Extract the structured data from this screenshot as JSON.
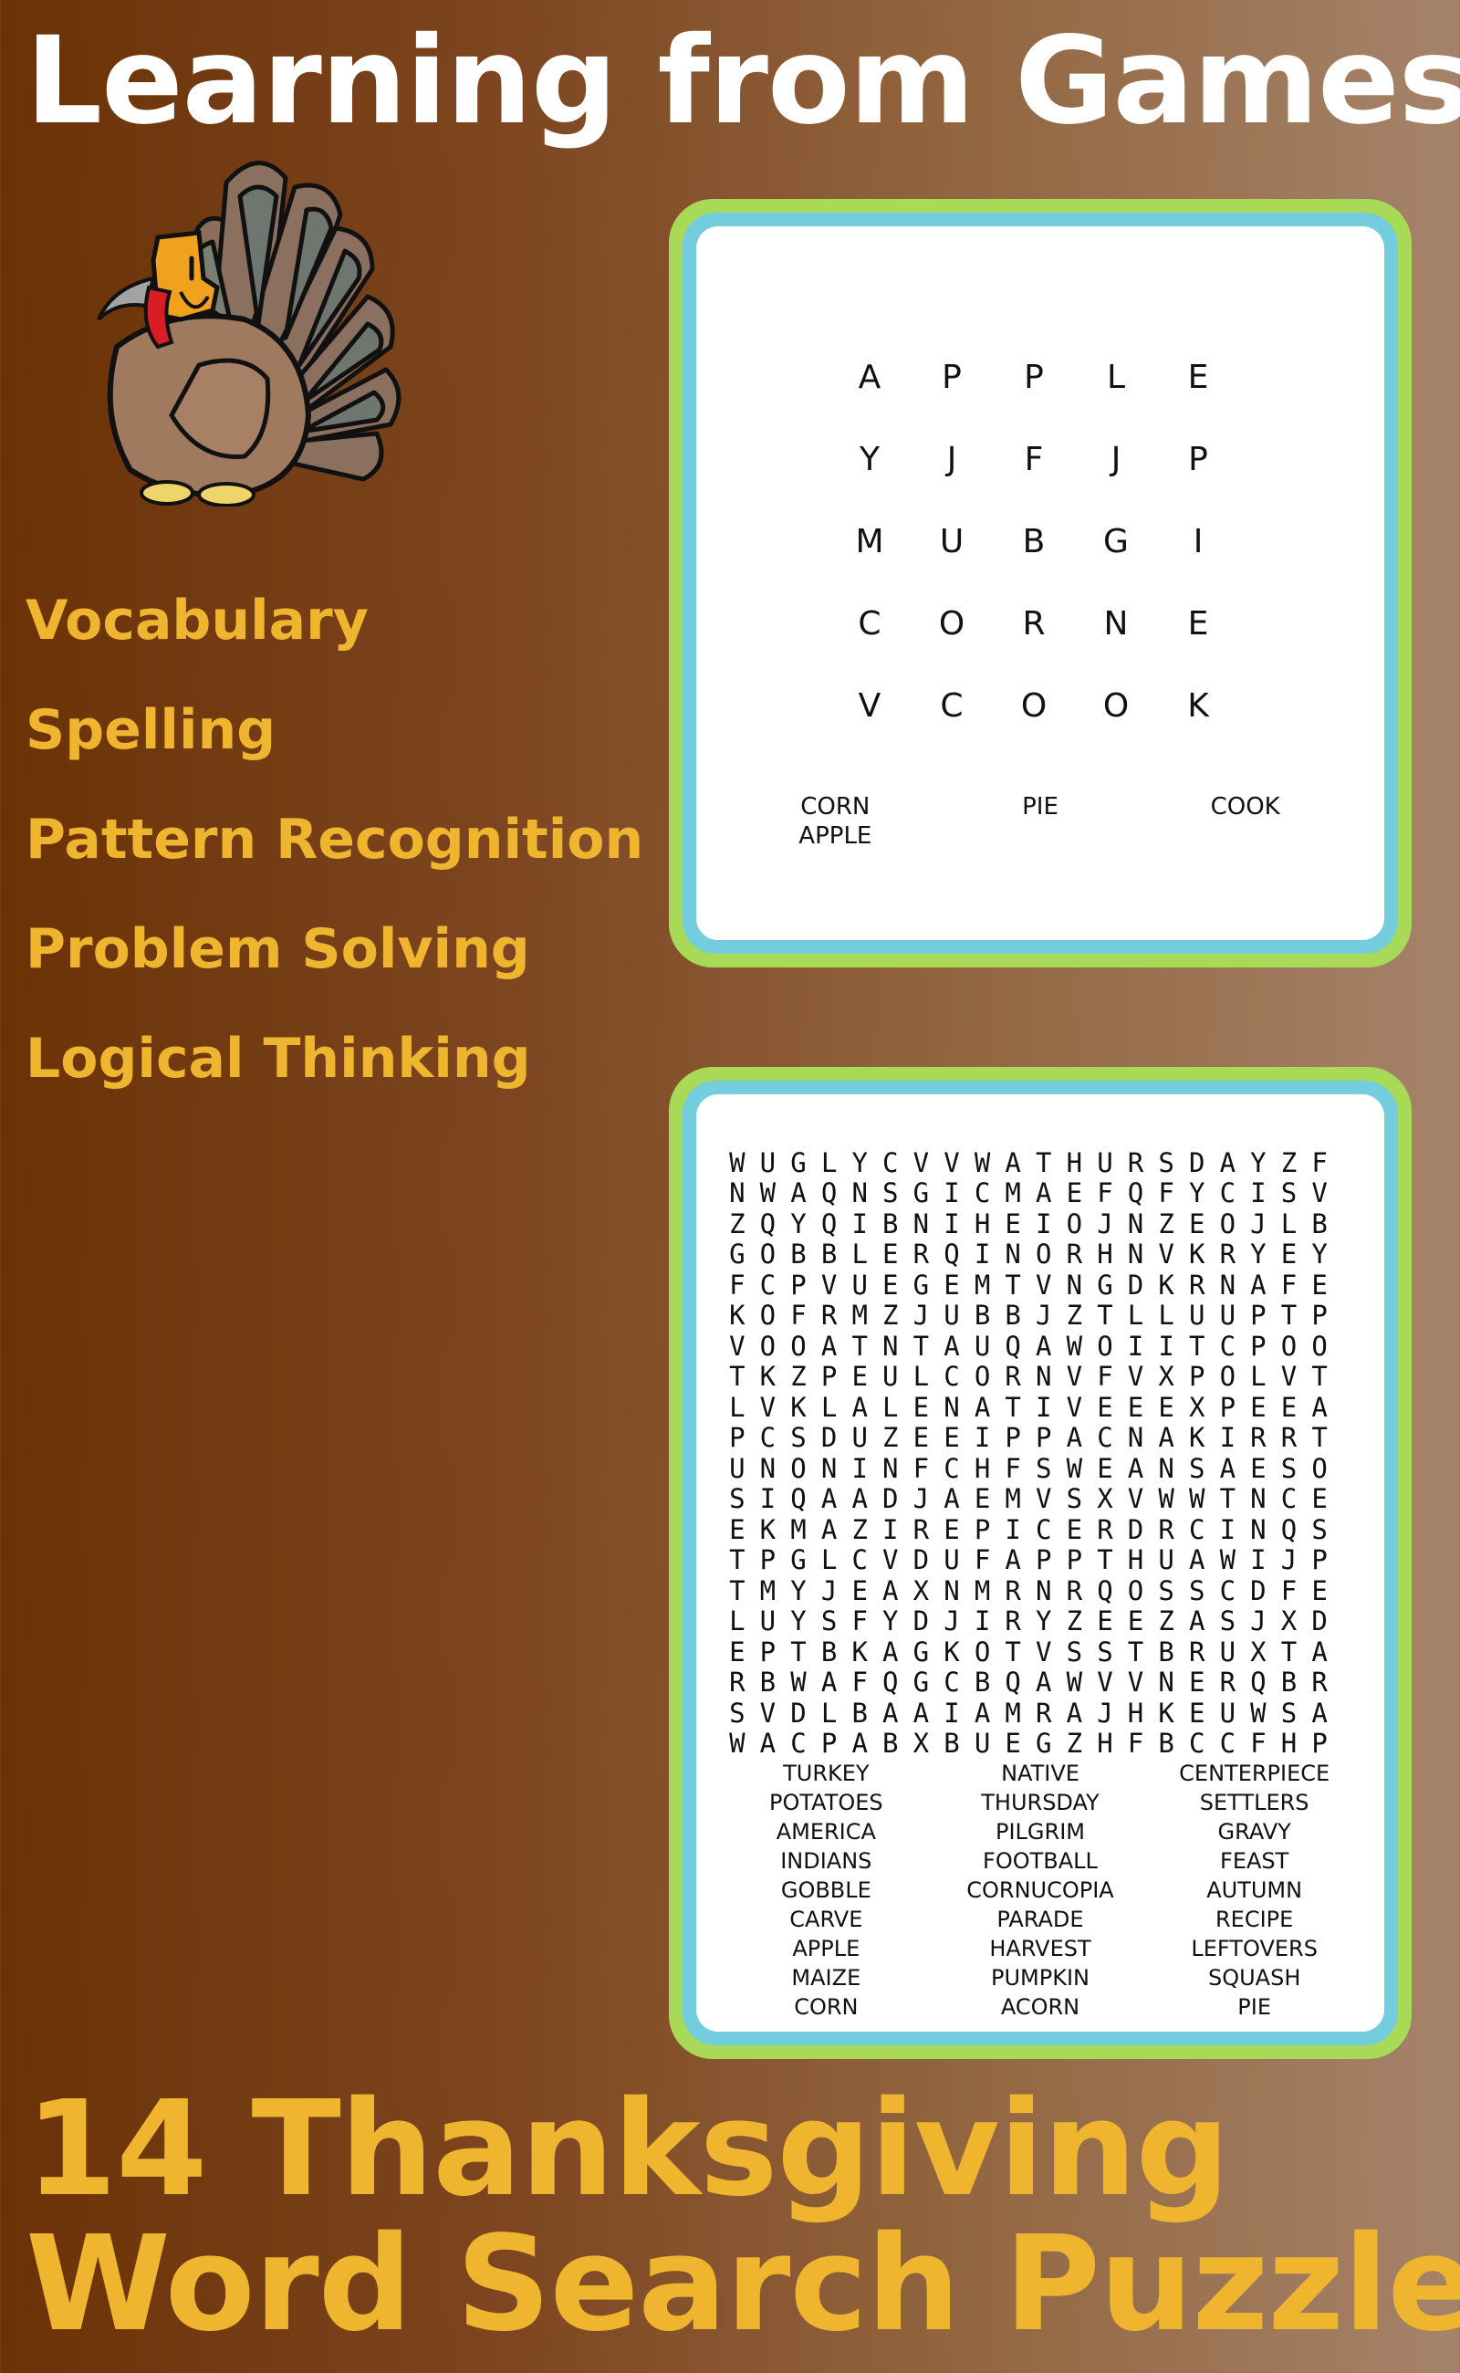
{
  "header": {
    "title": "Learning from Games"
  },
  "colors": {
    "title_text": "#ffffff",
    "accent_text": "#efb52f",
    "frame_outer": "#a8d957",
    "frame_inner": "#74cddc",
    "background_left": "#6b3206",
    "background_right": "#a5836a"
  },
  "illustration": {
    "icon": "turkey-icon"
  },
  "skills": [
    "Vocabulary",
    "Spelling",
    "Pattern Recognition",
    "Problem Solving",
    "Logical Thinking"
  ],
  "small_puzzle": {
    "grid": [
      [
        "A",
        "P",
        "P",
        "L",
        "E"
      ],
      [
        "Y",
        "J",
        "F",
        "J",
        "P"
      ],
      [
        "M",
        "U",
        "B",
        "G",
        "I"
      ],
      [
        "C",
        "O",
        "R",
        "N",
        "E"
      ],
      [
        "V",
        "C",
        "O",
        "O",
        "K"
      ]
    ],
    "words": [
      [
        "CORN",
        "APPLE"
      ],
      [
        "PIE"
      ],
      [
        "COOK"
      ]
    ]
  },
  "large_puzzle": {
    "grid": [
      "WUGLYCVVWATHURSDAYZF",
      "NWAQNSGICMAEFQFYCISV",
      "ZQYQIBNIHEIOJNZEOJLB",
      "GOBBLERQINORHNVKRYEY",
      "FCPVUEGEMTVNGDKRNAFE",
      "KOFRMZJUBBJZTLLUUPTP",
      "VOOATNTAUQAWOIITCPOO",
      "TKZPEULCORNVFVXPOLVT",
      "LVKLALENATIVEEEXPEEA",
      "PCSDUZEEIPPACNAKIRRT",
      "UNONINFCHFSWEANSAESO",
      "SIQAADJAEMVSXVWWTNCE",
      "EKMAZIREPICERDRCINQS",
      "TPGLCVDUFAPPTHUAWIJP",
      "TMYJEAXNMRNRQOSSCDFE",
      "LUYSFYDJIRYZEEZASJXD",
      "EPTBKAGKOTVSSTBRUXTA",
      "RBWAFQGCBQAWVVNERQBR",
      "SVDLBAAIAMRAJHKEUWSA",
      "WACPABXBUEGZHFBCCFHP"
    ],
    "word_columns": [
      [
        "TURKEY",
        "POTATOES",
        "AMERICA",
        "INDIANS",
        "GOBBLE",
        "CARVE",
        "APPLE",
        "MAIZE",
        "CORN"
      ],
      [
        "NATIVE",
        "THURSDAY",
        "PILGRIM",
        "FOOTBALL",
        "CORNUCOPIA",
        "PARADE",
        "HARVEST",
        "PUMPKIN",
        "ACORN"
      ],
      [
        "CENTERPIECE",
        "SETTLERS",
        "GRAVY",
        "FEAST",
        "AUTUMN",
        "RECIPE",
        "LEFTOVERS",
        "SQUASH",
        "PIE"
      ]
    ]
  },
  "footer": {
    "line1": "14 Thanksgiving",
    "line2": "Word Search Puzzles"
  }
}
